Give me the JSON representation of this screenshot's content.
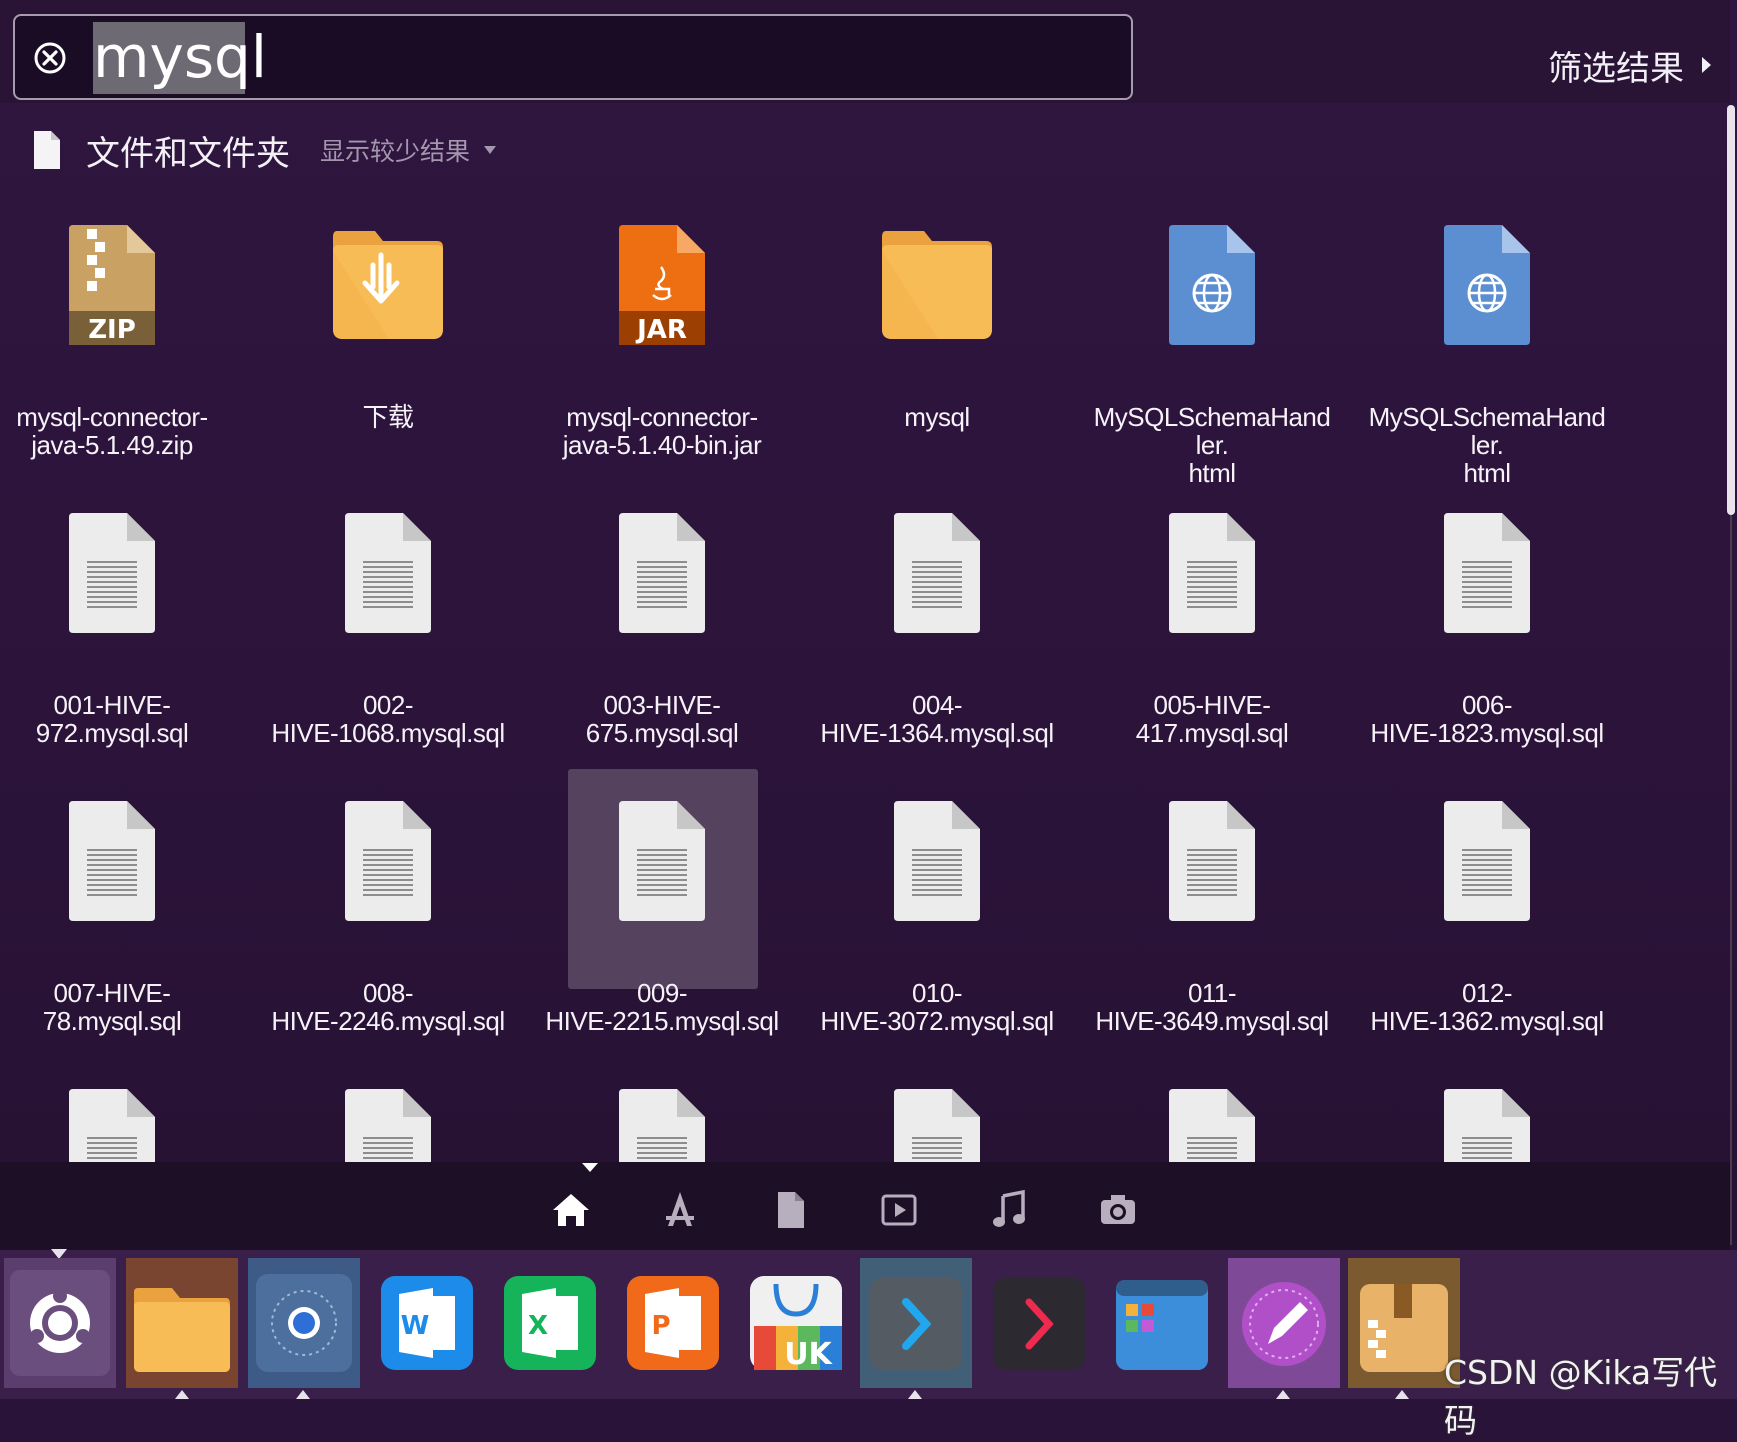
{
  "search": {
    "query": "mysql"
  },
  "filter": {
    "label": "筛选结果"
  },
  "category": {
    "title": "文件和文件夹",
    "toggle": "显示较少结果"
  },
  "results": [
    {
      "name": "mysql-connector-java-5.1.49.zip",
      "line1": "mysql-connector-",
      "line2": "java-5.1.49.zip",
      "icon": "zip-archive-icon",
      "kind": "zip"
    },
    {
      "name": "下载",
      "line1": "下载",
      "line2": "",
      "icon": "downloads-folder-icon",
      "kind": "download-folder"
    },
    {
      "name": "mysql-connector-java-5.1.40-bin.jar",
      "line1": "mysql-connector-",
      "line2": "java-5.1.40-bin.jar",
      "icon": "jar-file-icon",
      "kind": "jar"
    },
    {
      "name": "mysql",
      "line1": "mysql",
      "line2": "",
      "icon": "folder-icon",
      "kind": "folder"
    },
    {
      "name": "MySQLSchemaHandler.html",
      "line1": "MySQLSchemaHandler.",
      "line2": "html",
      "icon": "html-file-icon",
      "kind": "html"
    },
    {
      "name": "MySQLSchemaHandler.html",
      "line1": "MySQLSchemaHandler.",
      "line2": "html",
      "icon": "html-file-icon",
      "kind": "html"
    },
    {
      "name": "001-HIVE-972.mysql.sql",
      "line1": "001-HIVE-972.mysql.sql",
      "line2": "",
      "icon": "text-file-icon",
      "kind": "text"
    },
    {
      "name": "002-HIVE-1068.mysql.sql",
      "line1": "002-",
      "line2": "HIVE-1068.mysql.sql",
      "icon": "text-file-icon",
      "kind": "text"
    },
    {
      "name": "003-HIVE-675.mysql.sql",
      "line1": "003-HIVE-675.mysql.sql",
      "line2": "",
      "icon": "text-file-icon",
      "kind": "text"
    },
    {
      "name": "004-HIVE-1364.mysql.sql",
      "line1": "004-",
      "line2": "HIVE-1364.mysql.sql",
      "icon": "text-file-icon",
      "kind": "text"
    },
    {
      "name": "005-HIVE-417.mysql.sql",
      "line1": "005-HIVE-417.mysql.sql",
      "line2": "",
      "icon": "text-file-icon",
      "kind": "text"
    },
    {
      "name": "006-HIVE-1823.mysql.sql",
      "line1": "006-",
      "line2": "HIVE-1823.mysql.sql",
      "icon": "text-file-icon",
      "kind": "text"
    },
    {
      "name": "007-HIVE-78.mysql.sql",
      "line1": "007-HIVE-78.mysql.sql",
      "line2": "",
      "icon": "text-file-icon",
      "kind": "text"
    },
    {
      "name": "008-HIVE-2246.mysql.sql",
      "line1": "008-",
      "line2": "HIVE-2246.mysql.sql",
      "icon": "text-file-icon",
      "kind": "text"
    },
    {
      "name": "009-HIVE-2215.mysql.sql",
      "line1": "009-",
      "line2": "HIVE-2215.mysql.sql",
      "icon": "text-file-icon",
      "kind": "text",
      "selected": true
    },
    {
      "name": "010-HIVE-3072.mysql.sql",
      "line1": "010-",
      "line2": "HIVE-3072.mysql.sql",
      "icon": "text-file-icon",
      "kind": "text"
    },
    {
      "name": "011-HIVE-3649.mysql.sql",
      "line1": "011-",
      "line2": "HIVE-3649.mysql.sql",
      "icon": "text-file-icon",
      "kind": "text"
    },
    {
      "name": "012-HIVE-1362.mysql.sql",
      "line1": "012-",
      "line2": "HIVE-1362.mysql.sql",
      "icon": "text-file-icon",
      "kind": "text"
    },
    {
      "name": "",
      "line1": "",
      "line2": "",
      "icon": "text-file-icon",
      "kind": "text"
    },
    {
      "name": "",
      "line1": "",
      "line2": "",
      "icon": "text-file-icon",
      "kind": "text"
    },
    {
      "name": "",
      "line1": "",
      "line2": "",
      "icon": "text-file-icon",
      "kind": "text"
    },
    {
      "name": "",
      "line1": "",
      "line2": "",
      "icon": "text-file-icon",
      "kind": "text"
    },
    {
      "name": "",
      "line1": "",
      "line2": "",
      "icon": "text-file-icon",
      "kind": "text"
    },
    {
      "name": "",
      "line1": "",
      "line2": "",
      "icon": "text-file-icon",
      "kind": "text"
    }
  ],
  "lenses": [
    "home-lens-icon",
    "applications-lens-icon",
    "files-lens-icon",
    "video-lens-icon",
    "music-lens-icon",
    "photos-lens-icon"
  ],
  "launcher": [
    {
      "name": "dash-home",
      "icon": "ubuntu-logo-icon"
    },
    {
      "name": "files",
      "icon": "files-folder-icon"
    },
    {
      "name": "chromium",
      "icon": "browser-icon"
    },
    {
      "name": "wps-writer",
      "icon": "word-icon",
      "letter": "W"
    },
    {
      "name": "wps-spreadsheets",
      "icon": "excel-icon",
      "letter": "X"
    },
    {
      "name": "wps-presentation",
      "icon": "powerpoint-icon",
      "letter": "P"
    },
    {
      "name": "ubuntu-kylin-store",
      "icon": "software-center-icon",
      "letter": "UK"
    },
    {
      "name": "terminal-active",
      "icon": "terminal-icon"
    },
    {
      "name": "terminal",
      "icon": "terminal-dark-icon"
    },
    {
      "name": "workspace-switcher",
      "icon": "workspace-icon"
    },
    {
      "name": "text-editor",
      "icon": "editor-icon"
    },
    {
      "name": "archive-manager",
      "icon": "archive-icon"
    }
  ],
  "watermark": "CSDN @Kika写代码",
  "colors": {
    "dash_bg": "#2b1339",
    "selection": "#54425e",
    "folder": "#f7b751",
    "zip": "#c8a163",
    "jar": "#ee6f12",
    "html": "#5a8fd0"
  }
}
